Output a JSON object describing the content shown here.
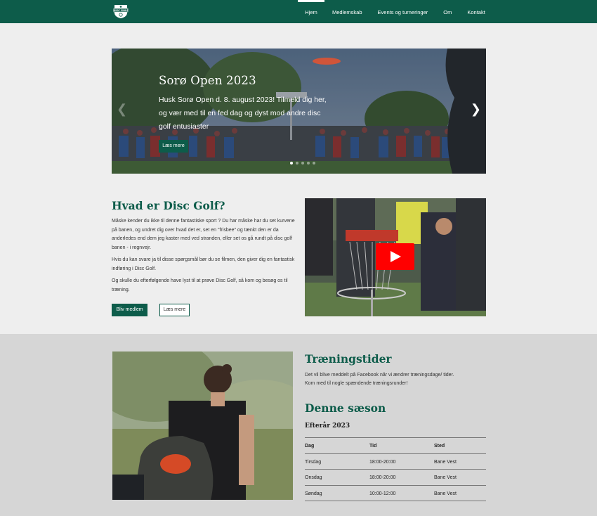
{
  "nav": {
    "logo_name": "disc-golf-logo",
    "items": [
      {
        "label": "Hjem"
      },
      {
        "label": "Medlemskab"
      },
      {
        "label": "Events og turneringer"
      },
      {
        "label": "Om"
      },
      {
        "label": "Kontakt"
      }
    ]
  },
  "hero": {
    "title": "Sorø Open 2023",
    "text": "Husk Sorø Open d. 8. august 2023! Tilmeld dig her, og vær med til en fed dag og dyst mod andre disc golf entusiaster",
    "button": "Læs mere",
    "prev_icon": "chevron-left-icon",
    "next_icon": "chevron-right-icon",
    "slides": 5,
    "active_slide": 1
  },
  "what": {
    "title": "Hvad er Disc Golf?",
    "p1": "Måske kender du ikke til denne fantastiske sport ? Du har måske har du set kurvene på banen, og undret dig over hvad det er, set en \"frisbee\" og tænkt den er da anderledes end dem jeg kaster med ved stranden, eller set os gå rundt på disc golf banen - i regnvejr.",
    "p2": "Hvis du kan svare ja til disse spørgsmål bør du se filmen, den giver dig en fantastisk indføring i Disc Golf.",
    "p3": "Og skulle du efterfølgende have lyst til at prøve Disc Golf, så kom og besøg os til træning.",
    "btn_member": "Bliv medlem",
    "btn_more": "Læs mere",
    "video_icon": "play-icon"
  },
  "training": {
    "title": "Træningstider",
    "text_line1": "Det vil blive meddelt på Facebook når vi ændrer træningsdage/ tider.",
    "text_line2": "Kom med til nogle spændende træningsrunder!"
  },
  "season": {
    "title": "Denne sæson",
    "subtitle": "Efterår 2023",
    "headers": [
      "Dag",
      "Tid",
      "Sted"
    ],
    "rows": [
      [
        "Tirsdag",
        "18:00-20:00",
        "Bane Vest"
      ],
      [
        "Onsdag",
        "18:00-20:00",
        "Bane Vest"
      ],
      [
        "Søndag",
        "10:00-12:00",
        "Bane Vest"
      ]
    ]
  },
  "colors": {
    "brand": "#0d5c4a",
    "page_bg": "#eeeeee",
    "section_bg": "#d6d6d6",
    "play_red": "#ff0000"
  }
}
